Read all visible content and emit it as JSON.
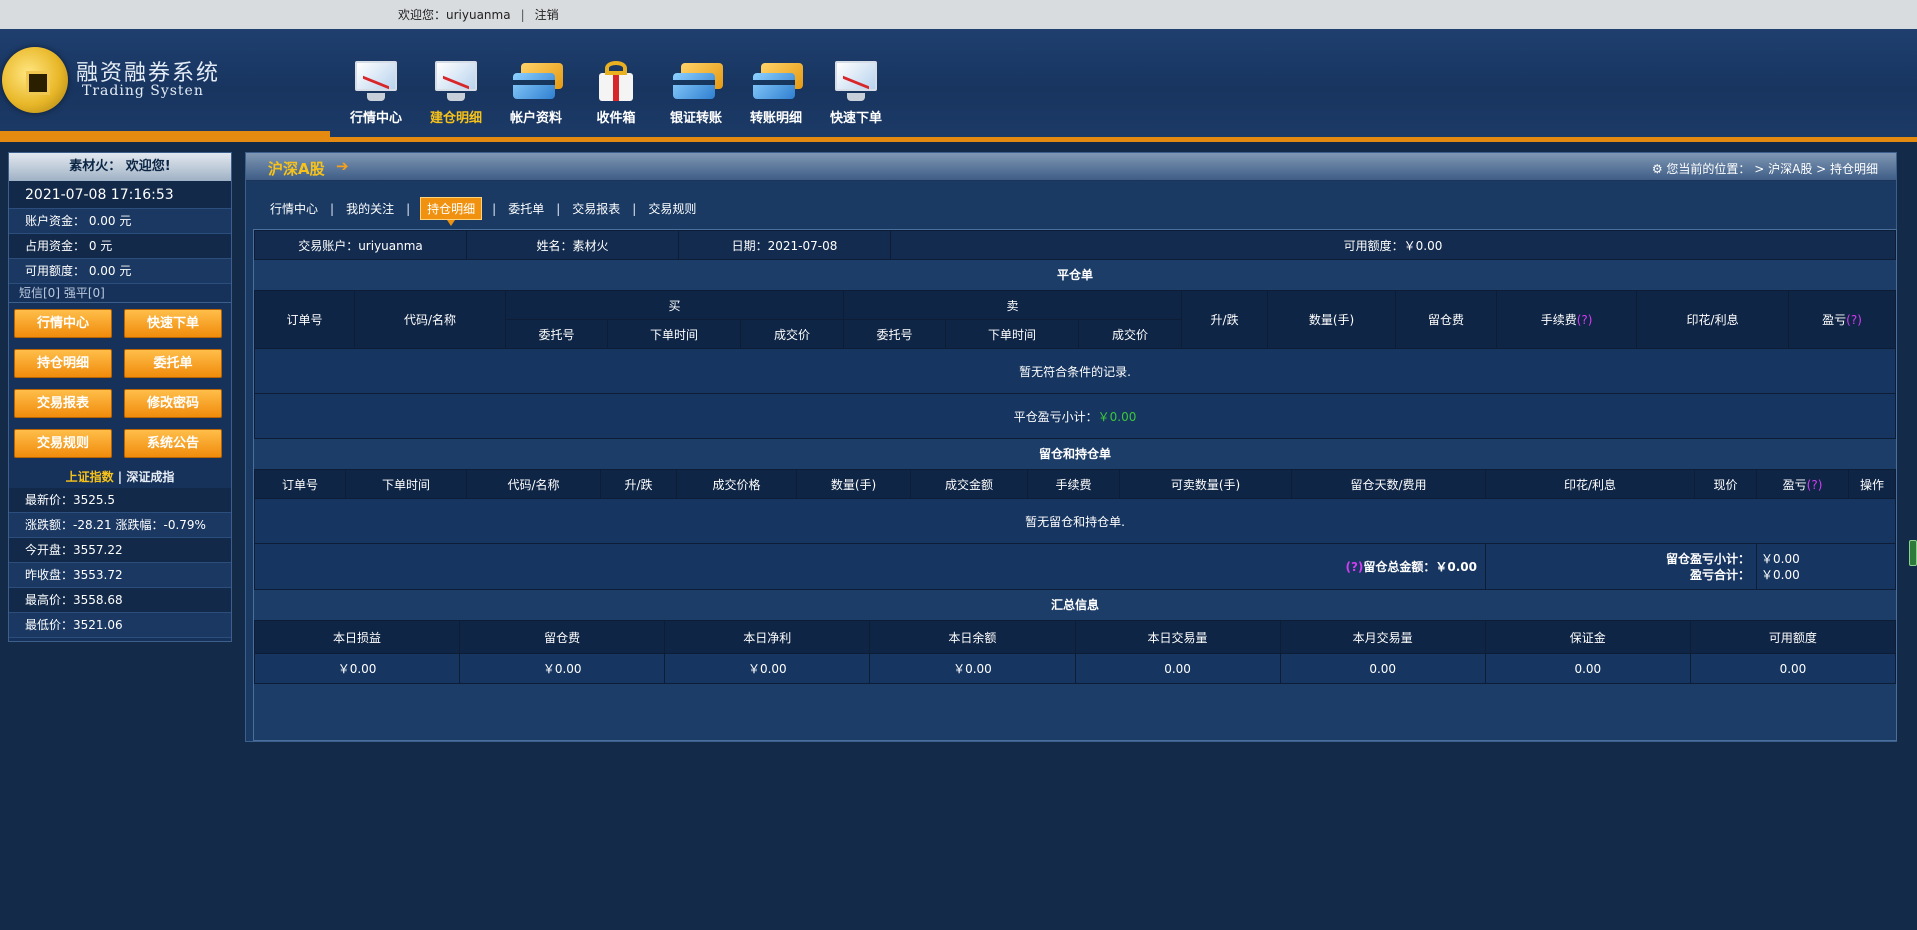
{
  "topbar": {
    "welcome": "欢迎您：uriyuanma",
    "logout": "注销"
  },
  "logo": {
    "cn": "融资融券系统",
    "en": "Trading Systen"
  },
  "nav": [
    {
      "label": "行情中心",
      "icon": "monitor-chart-icon"
    },
    {
      "label": "建仓明细",
      "icon": "monitor-chart-icon",
      "active": true
    },
    {
      "label": "帐户资料",
      "icon": "credit-cards-icon"
    },
    {
      "label": "收件箱",
      "icon": "gift-box-icon"
    },
    {
      "label": "银证转账",
      "icon": "credit-cards-icon"
    },
    {
      "label": "转账明细",
      "icon": "credit-cards-icon"
    },
    {
      "label": "快速下单",
      "icon": "monitor-chart-icon"
    }
  ],
  "sidebar": {
    "greeting": "素材火： 欢迎您!",
    "datetime": "2021-07-08 17:16:53",
    "account_funds": "账户资金：  0.00  元",
    "used_funds": "占用资金：   0  元",
    "available": "可用额度：  0.00  元",
    "sms": "短信[0] 强平[0]",
    "buttons": [
      "行情中心",
      "快速下单",
      "持仓明细",
      "委托单",
      "交易报表",
      "修改密码",
      "交易规则",
      "系统公告"
    ],
    "index_sh": "上证指数",
    "index_sep": " | ",
    "index_sz": "深证成指",
    "quotes": [
      "最新价：3525.5",
      "涨跌额：-28.21  涨跌幅：-0.79%",
      "今开盘：3557.22",
      "昨收盘：3553.72",
      "最高价：3558.68",
      "最低价：3521.06"
    ]
  },
  "main": {
    "title": "沪深A股",
    "location": "您当前的位置：  > 沪深A股 > 持仓明细",
    "tabs": [
      "行情中心",
      "我的关注",
      "持仓明细",
      "委托单",
      "交易报表",
      "交易规则"
    ],
    "active_tab": "持仓明细",
    "info": {
      "account": "交易账户：uriyuanma",
      "name": "姓名：素材火",
      "date": "日期：2021-07-08",
      "available": "可用额度：￥0.00"
    },
    "close_section": {
      "title": "平仓单",
      "col_order": "订单号",
      "col_code": "代码/名称",
      "buy": "买",
      "sell": "卖",
      "col_change": "升/跌",
      "col_qty": "数量(手)",
      "col_fee_keep": "留仓费",
      "col_fee_handle": "手续费",
      "col_stamp": "印花/利息",
      "col_pnl": "盈亏",
      "qmark": "(?)",
      "sub_entrust": "委托号",
      "sub_time": "下单时间",
      "sub_price": "成交价",
      "empty": "暂无符合条件的记录.",
      "subtotal_label": "平仓盈亏小计：",
      "subtotal_value": "￥0.00"
    },
    "hold_section": {
      "title": "留仓和持仓单",
      "columns": [
        "订单号",
        "下单时间",
        "代码/名称",
        "升/跌",
        "成交价格",
        "数量(手)",
        "成交金额",
        "手续费",
        "可卖数量(手)",
        "留仓天数/费用",
        "印花/利息",
        "现价",
        "盈亏",
        "操作"
      ],
      "qmark": "(?)",
      "empty": "暂无留仓和持仓单.",
      "total_label": "留仓总金额：￥0.00",
      "subtotal_label": "留仓盈亏小计：",
      "pnl_label": "盈亏合计：",
      "subtotal_value": "￥0.00",
      "pnl_value": "￥0.00"
    },
    "summary": {
      "title": "汇总信息",
      "headers": [
        "本日损益",
        "留仓费",
        "本日净利",
        "本日余额",
        "本日交易量",
        "本月交易量",
        "保证金",
        "可用额度"
      ],
      "values": [
        "￥0.00",
        "￥0.00",
        "￥0.00",
        "￥0.00",
        "0.00",
        "0.00",
        "0.00",
        "0.00"
      ]
    }
  }
}
